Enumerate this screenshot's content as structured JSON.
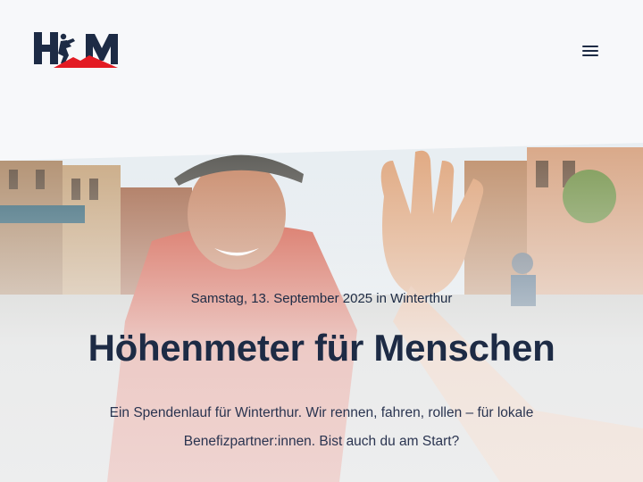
{
  "brand": {
    "logo_text": "HFM",
    "logo_colors": {
      "navy": "#1d2b45",
      "red": "#e31b23"
    }
  },
  "header": {
    "menu_icon": "hamburger-menu-icon"
  },
  "hero": {
    "date_line": "Samstag, 13. September 2025 in Winterthur",
    "title": "Höhenmeter für Menschen",
    "intro": "Ein Spendenlauf für Winterthur. Wir rennen, fahren, rollen – für lokale Benefizpartner:innen. Bist auch du am Start?"
  }
}
